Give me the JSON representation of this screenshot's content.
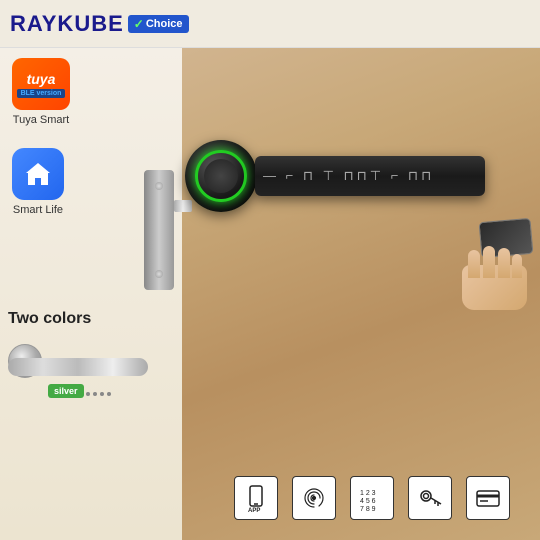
{
  "header": {
    "brand": "RAYKUBE",
    "choice_check": "✓",
    "choice_label": "Choice"
  },
  "tuya": {
    "name": "tuya",
    "ble_label": "BLE version",
    "caption": "Tuya Smart"
  },
  "smart_life": {
    "caption": "Smart Life"
  },
  "two_colors": {
    "title": "Two colors",
    "silver_label": "silver"
  },
  "lock": {
    "bar_symbols": [
      "—",
      "⌐",
      "⊓",
      "⊤",
      "⊓",
      "⊓",
      "⊓",
      "⊤",
      "⌐",
      "⊓"
    ]
  },
  "bottom_icons": [
    {
      "id": "app",
      "label": "APP"
    },
    {
      "id": "fingerprint",
      "label": "FP"
    },
    {
      "id": "keypad",
      "label": "123"
    },
    {
      "id": "key",
      "label": "KEY"
    },
    {
      "id": "card",
      "label": "CARD"
    }
  ]
}
